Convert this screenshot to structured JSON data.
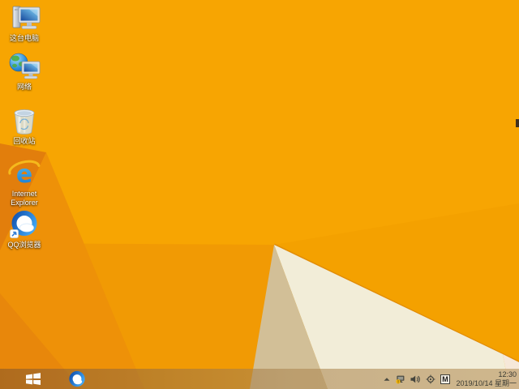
{
  "wallpaper": {
    "base": "#F7A502",
    "facet_right": "#F4A100",
    "facet_lower": "#F19A04",
    "facet_wedge": "#EE9108",
    "facet_topleft": "#E27E0C",
    "facet_bottomleft": "#E8870B",
    "fold_line": "#E18C05",
    "shadow_tan": "#D2BF97",
    "cream": "#F2EDD8",
    "cream_pink": "#F6E8D9"
  },
  "desktop": {
    "icons": [
      {
        "label": "这台电脑"
      },
      {
        "label": "网络"
      },
      {
        "label": "回收站"
      },
      {
        "label": "Internet Explorer"
      },
      {
        "label": "QQ浏览器"
      }
    ]
  },
  "taskbar": {
    "tray": {
      "input_indicator": "M"
    },
    "clock": {
      "time": "12:30",
      "date": "2019/10/14 星期一"
    }
  }
}
